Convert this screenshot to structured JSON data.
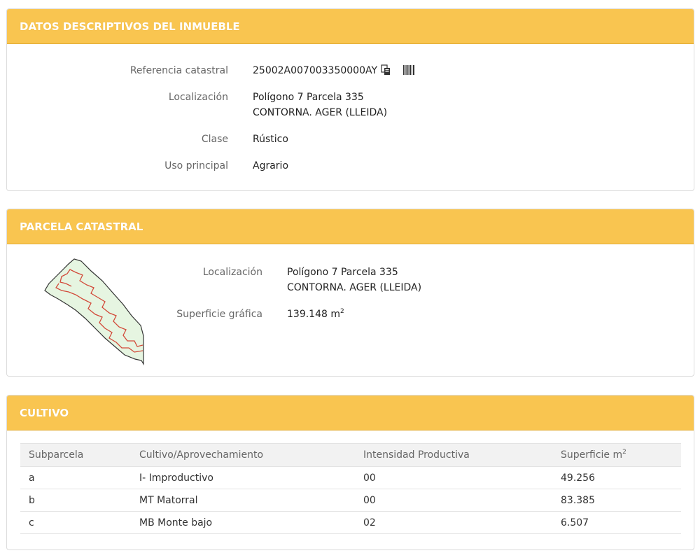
{
  "datos": {
    "header": "DATOS DESCRIPTIVOS DEL INMUEBLE",
    "referencia_label": "Referencia catastral",
    "referencia_value": "25002A007003350000AY",
    "localizacion_label": "Localización",
    "localizacion_line1": "Polígono 7 Parcela 335",
    "localizacion_line2": "CONTORNA. AGER (LLEIDA)",
    "clase_label": "Clase",
    "clase_value": "Rústico",
    "uso_label": "Uso principal",
    "uso_value": "Agrario"
  },
  "parcela": {
    "header": "PARCELA CATASTRAL",
    "localizacion_label": "Localización",
    "localizacion_line1": "Polígono 7 Parcela 335",
    "localizacion_line2": "CONTORNA. AGER (LLEIDA)",
    "superficie_label": "Superficie gráfica",
    "superficie_value": "139.148 m",
    "superficie_sup": "2"
  },
  "cultivo": {
    "header": "CULTIVO",
    "columns": [
      "Subparcela",
      "Cultivo/Aprovechamiento",
      "Intensidad Productiva",
      "Superficie m",
      "2"
    ],
    "rows": [
      {
        "subparcela": "a",
        "cultivo": "I- Improductivo",
        "intensidad": "00",
        "superficie": "49.256"
      },
      {
        "subparcela": "b",
        "cultivo": "MT Matorral",
        "intensidad": "00",
        "superficie": "83.385"
      },
      {
        "subparcela": "c",
        "cultivo": "MB Monte bajo",
        "intensidad": "02",
        "superficie": "6.507"
      }
    ]
  },
  "icons": {
    "copy": "copy-icon",
    "barcode": "barcode-icon"
  },
  "colors": {
    "header_bg": "#f9c550",
    "parcel_fill": "#e6f5e1",
    "parcel_line": "#d24a3a"
  }
}
